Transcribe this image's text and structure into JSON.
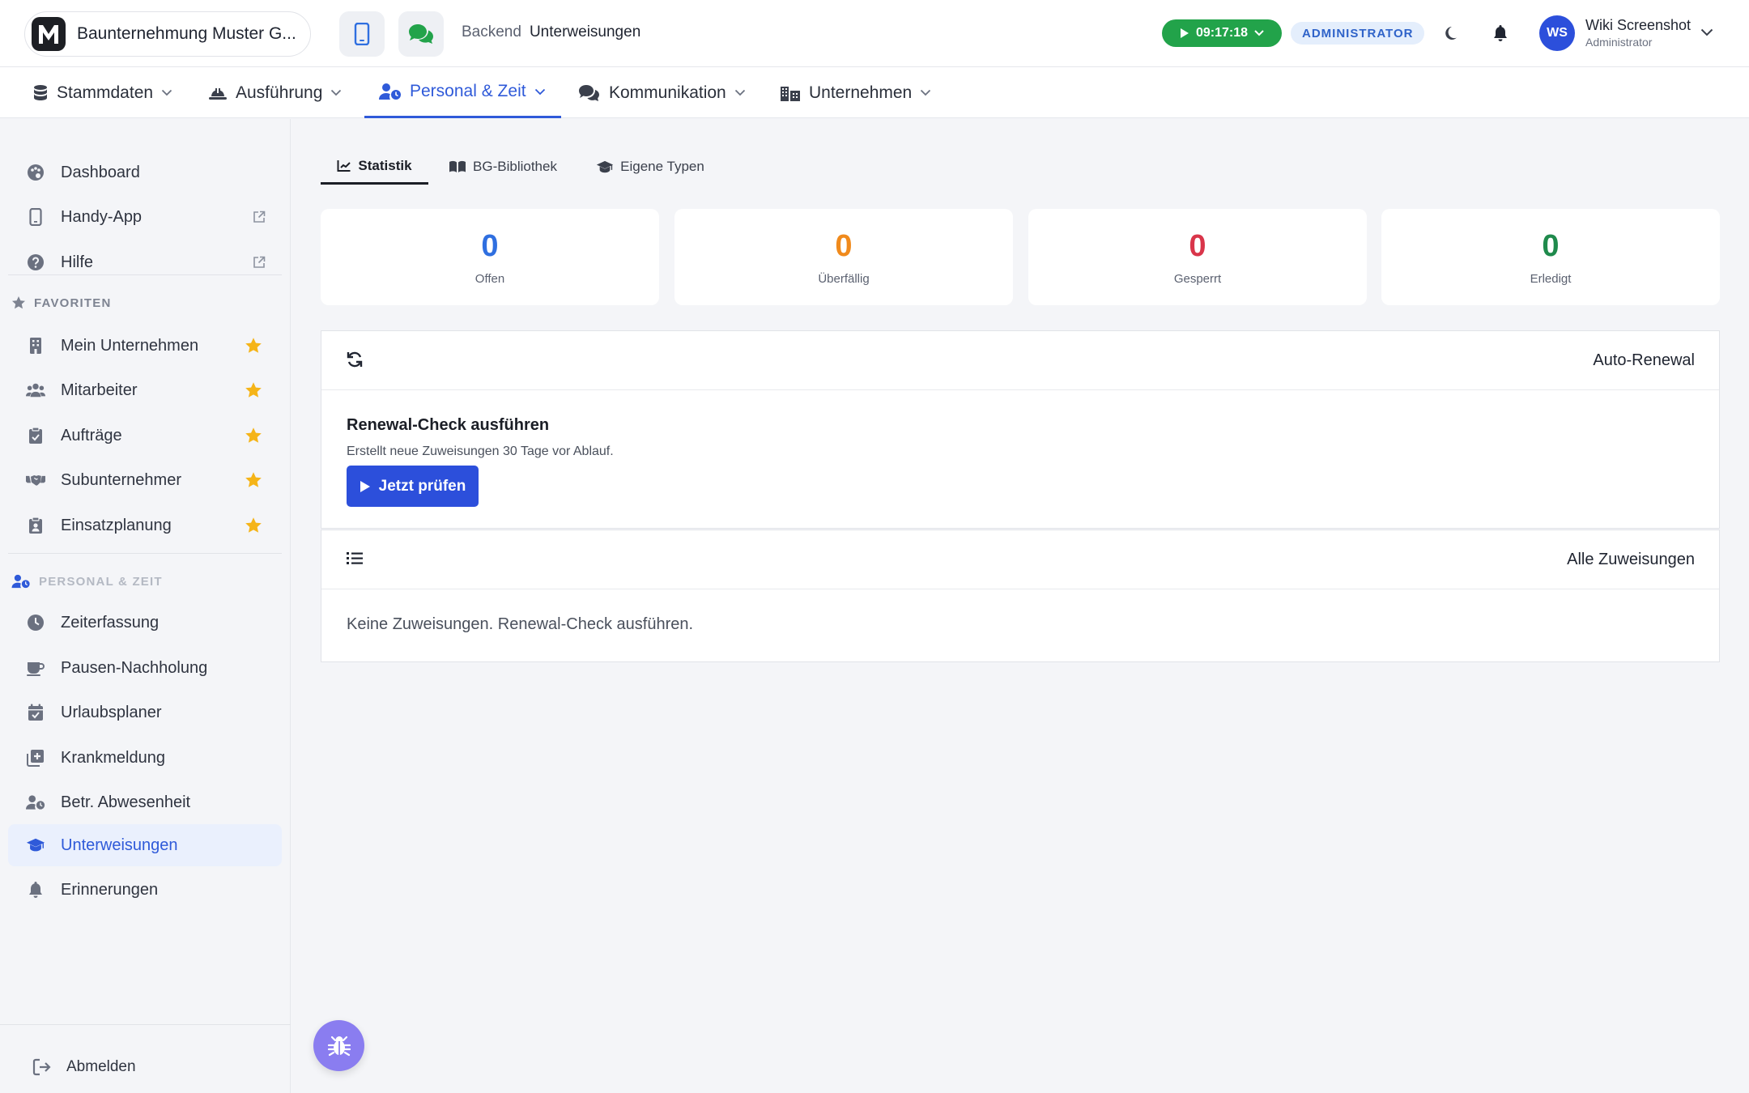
{
  "header": {
    "company_name": "Baunternehmung Muster G...",
    "logo_letter": "M",
    "breadcrumb": [
      "Backend",
      "Unterweisungen"
    ],
    "timer": "09:17:18",
    "role_badge": "ADMINISTRATOR",
    "user": {
      "initials": "WS",
      "name": "Wiki Screenshot",
      "role": "Administrator"
    }
  },
  "mainnav": [
    {
      "label": "Stammdaten",
      "icon": "database-icon"
    },
    {
      "label": "Ausführung",
      "icon": "hardhat-icon"
    },
    {
      "label": "Personal & Zeit",
      "icon": "user-clock-icon",
      "active": true
    },
    {
      "label": "Kommunikation",
      "icon": "comments-icon"
    },
    {
      "label": "Unternehmen",
      "icon": "building-icon"
    }
  ],
  "sidebar": {
    "top": [
      {
        "label": "Dashboard",
        "icon": "palette-icon"
      },
      {
        "label": "Handy-App",
        "icon": "mobile-icon",
        "external": true
      },
      {
        "label": "Hilfe",
        "icon": "question-icon",
        "external": true
      }
    ],
    "favorites_heading": "FAVORITEN",
    "favorites": [
      {
        "label": "Mein Unternehmen",
        "icon": "building-icon"
      },
      {
        "label": "Mitarbeiter",
        "icon": "users-icon"
      },
      {
        "label": "Aufträge",
        "icon": "clipboard-check-icon"
      },
      {
        "label": "Subunternehmer",
        "icon": "handshake-icon"
      },
      {
        "label": "Einsatzplanung",
        "icon": "clipboard-user-icon"
      }
    ],
    "section_heading": "PERSONAL & ZEIT",
    "section": [
      {
        "label": "Zeiterfassung",
        "icon": "clock-icon"
      },
      {
        "label": "Pausen-Nachholung",
        "icon": "coffee-icon"
      },
      {
        "label": "Urlaubsplaner",
        "icon": "calendar-check-icon"
      },
      {
        "label": "Krankmeldung",
        "icon": "notes-medical-icon"
      },
      {
        "label": "Betr. Abwesenheit",
        "icon": "user-clock-icon"
      },
      {
        "label": "Unterweisungen",
        "icon": "graduation-cap-icon",
        "active": true
      },
      {
        "label": "Erinnerungen",
        "icon": "bell-icon"
      }
    ],
    "logout": "Abmelden"
  },
  "tabs": [
    {
      "label": "Statistik",
      "icon": "chart-line-icon",
      "active": true
    },
    {
      "label": "BG-Bibliothek",
      "icon": "book-open-icon"
    },
    {
      "label": "Eigene Typen",
      "icon": "graduation-cap-icon"
    }
  ],
  "stats": [
    {
      "value": "0",
      "label": "Offen",
      "color": "#2f6fe0"
    },
    {
      "value": "0",
      "label": "Überfällig",
      "color": "#f08a1c"
    },
    {
      "value": "0",
      "label": "Gesperrt",
      "color": "#d9354a"
    },
    {
      "value": "0",
      "label": "Erledigt",
      "color": "#1f8a4c"
    }
  ],
  "renewal": {
    "title": "Auto-Renewal",
    "heading": "Renewal-Check ausführen",
    "description": "Erstellt neue Zuweisungen 30 Tage vor Ablauf.",
    "button": "Jetzt prüfen"
  },
  "assignments": {
    "title": "Alle Zuweisungen",
    "empty": "Keine Zuweisungen. Renewal-Check ausführen."
  },
  "colors": {
    "accent": "#2f5ad9",
    "primary_button": "#2c4fdb",
    "timer": "#22a34a",
    "star": "#f5b418",
    "bug_fab": "#8a7df0"
  }
}
